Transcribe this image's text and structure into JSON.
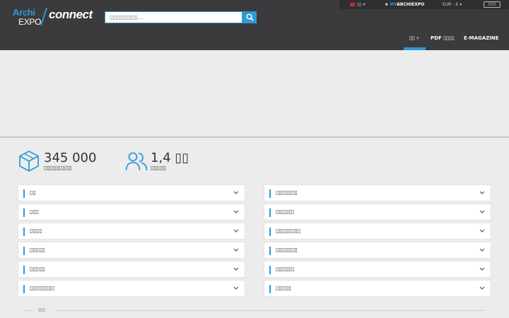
{
  "header": {
    "logo_archi": "Archi",
    "logo_expo": "EXPO",
    "logo_connect": "connect",
    "search_placeholder": "▯▯▯▯▯▯▯▯▯...",
    "language": "▯▯",
    "myarchi_my": "MY",
    "myarchi_rest": "ARCHIEXPO",
    "currency": "EUR - €",
    "login": "▯▯▯▯",
    "nav": [
      "▯▯",
      "PDF ▯▯▯▯",
      "E-MAGAZINE"
    ]
  },
  "stats": [
    {
      "number": "345 000",
      "label": "▯▯▯▯▯▯▯▯▯"
    },
    {
      "number": "1,4 ▯▯",
      "label": "▯▯▯▯▯"
    }
  ],
  "categories": {
    "left": [
      "▯▯",
      "▯▯▯",
      "▯▯▯▯",
      "▯▯▯▯▯",
      "▯▯▯▯▯",
      "▯▯▯▯▯▯▯▯"
    ],
    "right": [
      "▯▯▯▯▯▯▯",
      "▯▯▯▯▯▯",
      "▯▯▯▯▯▯▯▯",
      "▯▯▯▯▯▯▯",
      "▯▯▯▯▯▯",
      "▯▯▯▯▯"
    ]
  },
  "footer_label": "▯▯▯",
  "colors": {
    "accent": "#2e9ad6",
    "header": "#3b3b3d"
  }
}
